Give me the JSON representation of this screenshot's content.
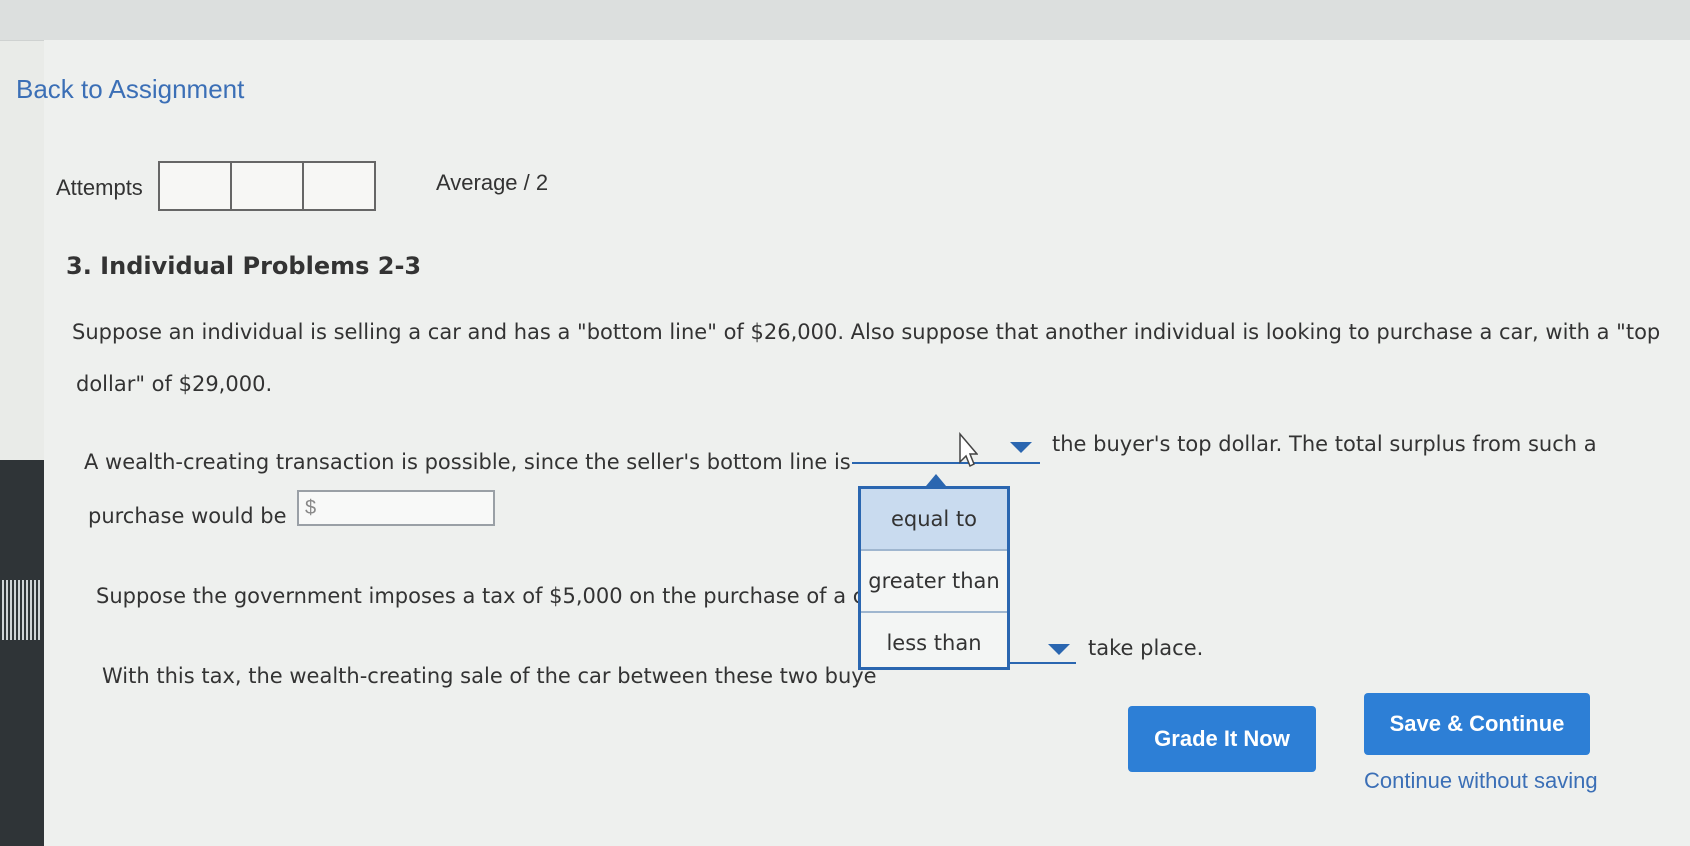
{
  "nav": {
    "back_link": "Back to Assignment"
  },
  "attempts": {
    "label": "Attempts",
    "average_label": "Average / 2"
  },
  "question": {
    "heading": "3. Individual Problems 2-3",
    "intro_line1": "Suppose an individual is selling a car and has a \"bottom line\" of $26,000. Also suppose that another individual is looking to purchase a car, with a \"top",
    "intro_line2": "dollar\" of $29,000.",
    "q1_before": "A wealth-creating transaction is possible, since the seller's bottom line is",
    "q1_after": "the buyer's top dollar. The total surplus from such a",
    "q1_line2": "purchase would be",
    "surplus_input_prefix": "$",
    "surplus_input_value": "",
    "tax_text": "Suppose the government imposes a tax of $5,000 on the purchase of a c",
    "q2_before": "With this tax, the wealth-creating sale of the car between these two buye",
    "q2_after": "take place."
  },
  "dropdown": {
    "options": [
      "equal to",
      "greater than",
      "less than"
    ],
    "highlighted": "equal to"
  },
  "actions": {
    "grade_button": "Grade It Now",
    "save_button": "Save & Continue",
    "continue_link": "Continue without saving"
  },
  "colors": {
    "accent": "#2d7fd6",
    "link": "#3b6fb6",
    "dropdown_border": "#2a66b0",
    "highlight": "#c9dbef"
  }
}
